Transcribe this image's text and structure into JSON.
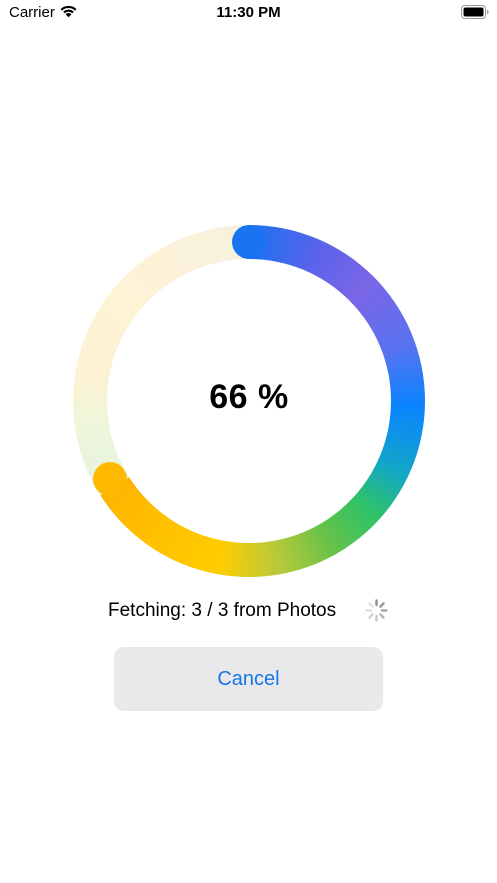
{
  "status_bar": {
    "carrier": "Carrier",
    "time": "11:30 PM",
    "wifi_icon": "wifi-icon",
    "battery_icon": "battery-full-icon"
  },
  "progress": {
    "value_percent": 66,
    "label": "66 %",
    "gradient_colors": [
      "#1a73f0",
      "#7a66e6",
      "#0a84ff",
      "#2ec26a",
      "#ffcc00",
      "#ffb400"
    ],
    "track_colors": [
      "#d6eaf8",
      "#e4f3e2",
      "#fff3d6"
    ]
  },
  "status": {
    "text": "Fetching: 3 / 3 from Photos",
    "activity_icon": "activity-spinner-icon"
  },
  "actions": {
    "cancel_label": "Cancel",
    "accent_color": "#1477e6"
  }
}
